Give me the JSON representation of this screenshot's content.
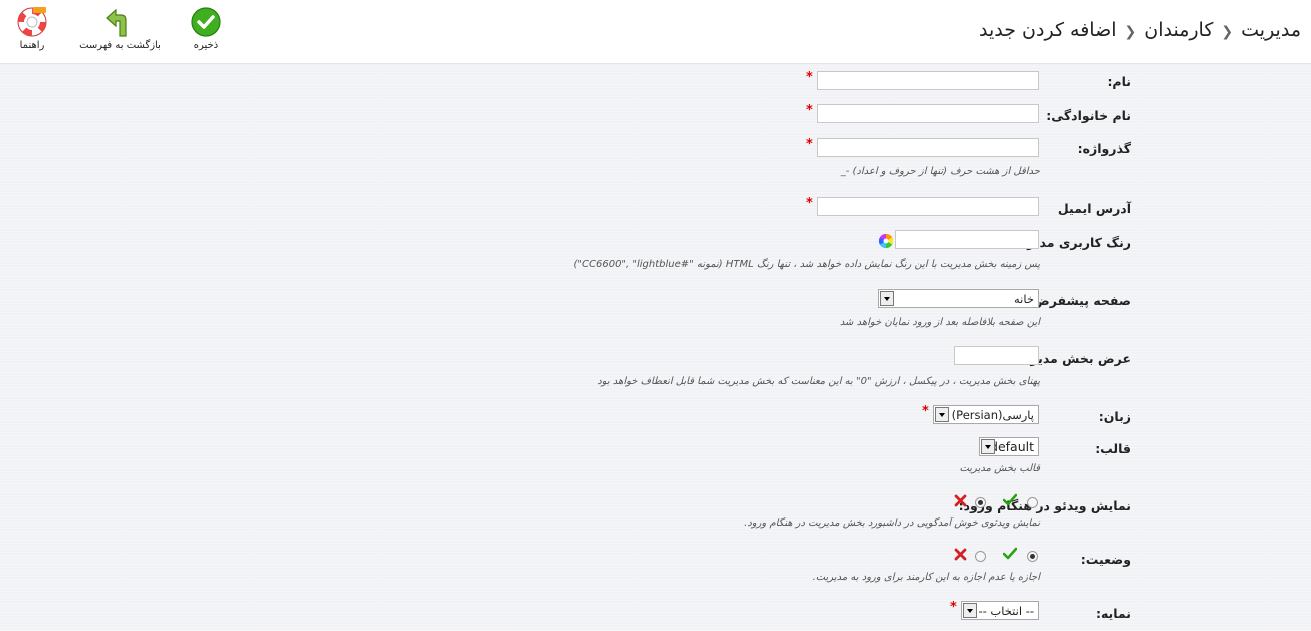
{
  "toolbar": {
    "save_label": "ذخیره",
    "back_label": "بازگشت به فهرست",
    "help_label": "راهنما"
  },
  "breadcrumb": {
    "items": [
      "مدیریت",
      "کارمندان",
      "اضافه کردن جدید"
    ]
  },
  "form": {
    "first_name": {
      "label": "نام:",
      "value": "",
      "required": "*"
    },
    "last_name": {
      "label": "نام خانوادگی:",
      "value": "",
      "required": "*"
    },
    "password": {
      "label": "گذرواژه:",
      "value": "",
      "required": "*",
      "hint": "حداقل از هشت حرف (تنها از حروف و اعداد) -_"
    },
    "email": {
      "label": "آدرس ایمیل",
      "value": "",
      "required": "*"
    },
    "admin_color": {
      "label": "رنگ کاربری مدیریت",
      "value": "",
      "hint": "پس زمینه بخش مدیریت با این رنگ نمایش داده خواهد شد ، تنها رنگ HTML (نمونه \"#CC6600\", \"lightblue\")"
    },
    "default_page": {
      "label": "صفحه پیشفرض:",
      "selected": "خانه",
      "hint": "این صفحه بلافاصله بعد از ورود نمایان خواهد شد"
    },
    "admin_width": {
      "label": "عرض بخش مدیریت",
      "value": "",
      "hint": "پهنای بخش مدیریت ، در پیکسل ، ارزش \"0\" به این معناست که بخش مدیریت شما قابل انعطاف خواهد بود"
    },
    "language": {
      "label": "زبان:",
      "selected": "پارسی(Persian)",
      "required": "*"
    },
    "theme": {
      "label": "قالب:",
      "selected": "default",
      "hint": "قالب بخش مدیریت"
    },
    "show_video": {
      "label": "نمایش ویدئو در هنگام ورود:",
      "hint": "نمایش ویدئوی خوش آمدگویی در داشبورد بخش مدیریت در هنگام ورود.",
      "selected": "no"
    },
    "status": {
      "label": "وضعیت:",
      "hint": "اجازه یا عدم اجازه به این کارمند برای ورود به مدیریت.",
      "selected": "yes"
    },
    "profile": {
      "label": "نمایه:",
      "selected": "-- انتخاب --",
      "required": "*"
    }
  },
  "colors": {
    "required": "#d00000",
    "yes": "#2aa10f",
    "no": "#d62020",
    "save": "#3fae1f"
  }
}
